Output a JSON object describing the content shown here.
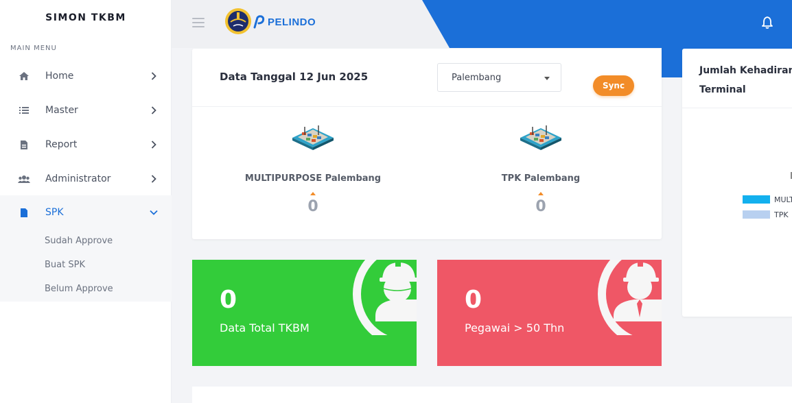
{
  "sidebar": {
    "brand": "SIMON TKBM",
    "heading": "MAIN MENU",
    "items": [
      {
        "label": "Home",
        "icon": "home-icon"
      },
      {
        "label": "Master",
        "icon": "list-icon"
      },
      {
        "label": "Report",
        "icon": "file-text-icon"
      },
      {
        "label": "Administrator",
        "icon": "users-icon"
      },
      {
        "label": "SPK",
        "icon": "file-icon"
      }
    ],
    "subitems": [
      "Sudah Approve",
      "Buat SPK",
      "Belum Approve"
    ]
  },
  "header": {
    "logo_text": "PELINDO"
  },
  "data_card": {
    "title": "Data Tanggal 12 Jun 2025",
    "select_value": "Palembang",
    "sync_label": "Sync",
    "terminals": [
      {
        "name": "MULTIPURPOSE Palembang",
        "value": "0"
      },
      {
        "name": "TPK Palembang",
        "value": "0"
      }
    ]
  },
  "chart_card": {
    "title": "Jumlah Kehadiran Terminal",
    "legend": [
      {
        "label": "MULT",
        "color": "#13b0ee"
      },
      {
        "label": "TPK",
        "color": "#b8d0f0"
      }
    ]
  },
  "stats": [
    {
      "value": "0",
      "label": "Data Total TKBM",
      "color": "#33cc3a"
    },
    {
      "value": "0",
      "label": "Pegawai > 50 Thn",
      "color": "#ef5766"
    }
  ],
  "colors": {
    "accent_blue": "#1b6fd8",
    "sync_orange": "#f28c28"
  }
}
